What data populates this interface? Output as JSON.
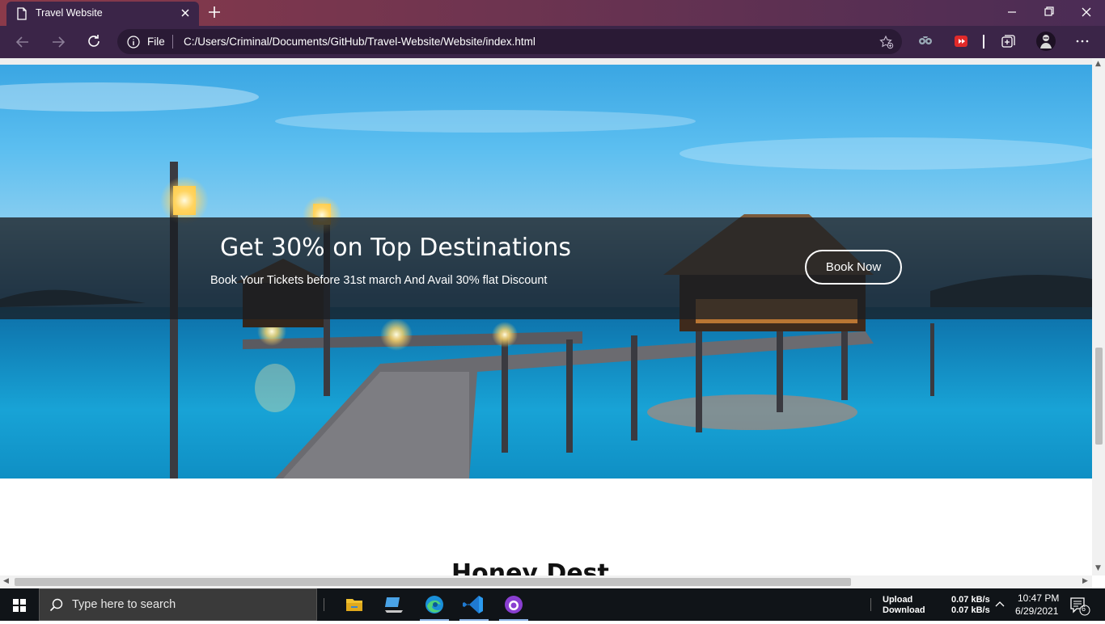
{
  "browser": {
    "tab_title": "Travel Website",
    "url_scheme": "File",
    "url_path": "C:/Users/Criminal/Documents/GitHub/Travel-Website/Website/index.html"
  },
  "hero": {
    "headline": "Get 30% on Top Destinations",
    "subtext": "Book Your Tickets before 31st march And Avail 30% flat Discount",
    "cta_label": "Book Now"
  },
  "next_section": {
    "heading_partial": "Honey Dest"
  },
  "taskbar": {
    "search_placeholder": "Type here to search",
    "net_upload_label": "Upload",
    "net_download_label": "Download",
    "net_upload_value": "0.07 kB/s",
    "net_download_value": "0.07 kB/s",
    "time": "10:47 PM",
    "date": "6/29/2021",
    "notification_count": "6"
  },
  "colors": {
    "chrome_tab_gradient_start": "#8b3a4a",
    "chrome_bg": "#3b2548",
    "banner_overlay": "#191e23",
    "taskbar_bg": "#101418"
  },
  "icons": [
    "page-icon",
    "close-tab-icon",
    "new-tab-icon",
    "minimize-icon",
    "restore-icon",
    "close-window-icon",
    "back-icon",
    "forward-icon",
    "refresh-icon",
    "info-icon",
    "favorite-add-icon",
    "extension-icon",
    "media-extension-icon",
    "collections-icon",
    "profile-avatar-icon",
    "more-menu-icon",
    "windows-start-icon",
    "search-icon",
    "file-explorer-icon",
    "laptop-icon",
    "edge-icon",
    "vscode-icon",
    "github-desktop-icon",
    "chevron-up-icon",
    "notification-icon"
  ]
}
